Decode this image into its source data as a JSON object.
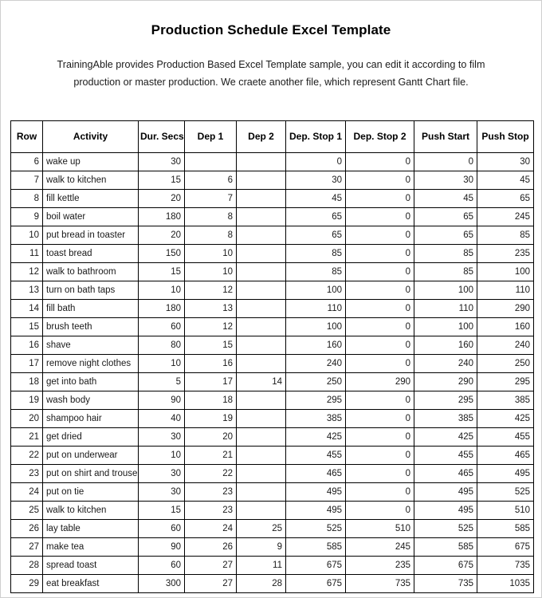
{
  "document": {
    "title": "Production Schedule Excel Template",
    "intro": "TrainingAble provides Production Based Excel Template sample, you can edit it according to film production or master production. We craete another file, which represent Gantt Chart file."
  },
  "table": {
    "headers": [
      "Row",
      "Activity",
      "Dur. Secs",
      "Dep 1",
      "Dep 2",
      "Dep. Stop 1",
      "Dep. Stop 2",
      "Push Start",
      "Push Stop"
    ],
    "rows": [
      {
        "row": "6",
        "activity": "wake up",
        "dur": "30",
        "dep1": "",
        "dep2": "",
        "dep_stop1": "0",
        "dep_stop2": "0",
        "push_start": "0",
        "push_stop": "30"
      },
      {
        "row": "7",
        "activity": "walk to kitchen",
        "dur": "15",
        "dep1": "6",
        "dep2": "",
        "dep_stop1": "30",
        "dep_stop2": "0",
        "push_start": "30",
        "push_stop": "45"
      },
      {
        "row": "8",
        "activity": "fill kettle",
        "dur": "20",
        "dep1": "7",
        "dep2": "",
        "dep_stop1": "45",
        "dep_stop2": "0",
        "push_start": "45",
        "push_stop": "65"
      },
      {
        "row": "9",
        "activity": "boil water",
        "dur": "180",
        "dep1": "8",
        "dep2": "",
        "dep_stop1": "65",
        "dep_stop2": "0",
        "push_start": "65",
        "push_stop": "245"
      },
      {
        "row": "10",
        "activity": "put bread in toaster",
        "dur": "20",
        "dep1": "8",
        "dep2": "",
        "dep_stop1": "65",
        "dep_stop2": "0",
        "push_start": "65",
        "push_stop": "85"
      },
      {
        "row": "11",
        "activity": "toast bread",
        "dur": "150",
        "dep1": "10",
        "dep2": "",
        "dep_stop1": "85",
        "dep_stop2": "0",
        "push_start": "85",
        "push_stop": "235"
      },
      {
        "row": "12",
        "activity": "walk to bathroom",
        "dur": "15",
        "dep1": "10",
        "dep2": "",
        "dep_stop1": "85",
        "dep_stop2": "0",
        "push_start": "85",
        "push_stop": "100"
      },
      {
        "row": "13",
        "activity": "turn on bath taps",
        "dur": "10",
        "dep1": "12",
        "dep2": "",
        "dep_stop1": "100",
        "dep_stop2": "0",
        "push_start": "100",
        "push_stop": "110"
      },
      {
        "row": "14",
        "activity": "fill bath",
        "dur": "180",
        "dep1": "13",
        "dep2": "",
        "dep_stop1": "110",
        "dep_stop2": "0",
        "push_start": "110",
        "push_stop": "290"
      },
      {
        "row": "15",
        "activity": "brush teeth",
        "dur": "60",
        "dep1": "12",
        "dep2": "",
        "dep_stop1": "100",
        "dep_stop2": "0",
        "push_start": "100",
        "push_stop": "160"
      },
      {
        "row": "16",
        "activity": "shave",
        "dur": "80",
        "dep1": "15",
        "dep2": "",
        "dep_stop1": "160",
        "dep_stop2": "0",
        "push_start": "160",
        "push_stop": "240"
      },
      {
        "row": "17",
        "activity": "remove night clothes",
        "dur": "10",
        "dep1": "16",
        "dep2": "",
        "dep_stop1": "240",
        "dep_stop2": "0",
        "push_start": "240",
        "push_stop": "250"
      },
      {
        "row": "18",
        "activity": "get into bath",
        "dur": "5",
        "dep1": "17",
        "dep2": "14",
        "dep_stop1": "250",
        "dep_stop2": "290",
        "push_start": "290",
        "push_stop": "295"
      },
      {
        "row": "19",
        "activity": "wash body",
        "dur": "90",
        "dep1": "18",
        "dep2": "",
        "dep_stop1": "295",
        "dep_stop2": "0",
        "push_start": "295",
        "push_stop": "385"
      },
      {
        "row": "20",
        "activity": "shampoo hair",
        "dur": "40",
        "dep1": "19",
        "dep2": "",
        "dep_stop1": "385",
        "dep_stop2": "0",
        "push_start": "385",
        "push_stop": "425"
      },
      {
        "row": "21",
        "activity": "get dried",
        "dur": "30",
        "dep1": "20",
        "dep2": "",
        "dep_stop1": "425",
        "dep_stop2": "0",
        "push_start": "425",
        "push_stop": "455"
      },
      {
        "row": "22",
        "activity": "put on underwear",
        "dur": "10",
        "dep1": "21",
        "dep2": "",
        "dep_stop1": "455",
        "dep_stop2": "0",
        "push_start": "455",
        "push_stop": "465"
      },
      {
        "row": "23",
        "activity": "put on shirt and trousers",
        "dur": "30",
        "dep1": "22",
        "dep2": "",
        "dep_stop1": "465",
        "dep_stop2": "0",
        "push_start": "465",
        "push_stop": "495"
      },
      {
        "row": "24",
        "activity": "put on tie",
        "dur": "30",
        "dep1": "23",
        "dep2": "",
        "dep_stop1": "495",
        "dep_stop2": "0",
        "push_start": "495",
        "push_stop": "525"
      },
      {
        "row": "25",
        "activity": "walk to kitchen",
        "dur": "15",
        "dep1": "23",
        "dep2": "",
        "dep_stop1": "495",
        "dep_stop2": "0",
        "push_start": "495",
        "push_stop": "510"
      },
      {
        "row": "26",
        "activity": "lay table",
        "dur": "60",
        "dep1": "24",
        "dep2": "25",
        "dep_stop1": "525",
        "dep_stop2": "510",
        "push_start": "525",
        "push_stop": "585"
      },
      {
        "row": "27",
        "activity": "make tea",
        "dur": "90",
        "dep1": "26",
        "dep2": "9",
        "dep_stop1": "585",
        "dep_stop2": "245",
        "push_start": "585",
        "push_stop": "675"
      },
      {
        "row": "28",
        "activity": "spread toast",
        "dur": "60",
        "dep1": "27",
        "dep2": "11",
        "dep_stop1": "675",
        "dep_stop2": "235",
        "push_start": "675",
        "push_stop": "735"
      },
      {
        "row": "29",
        "activity": "eat breakfast",
        "dur": "300",
        "dep1": "27",
        "dep2": "28",
        "dep_stop1": "675",
        "dep_stop2": "735",
        "push_start": "735",
        "push_stop": "1035"
      }
    ]
  }
}
